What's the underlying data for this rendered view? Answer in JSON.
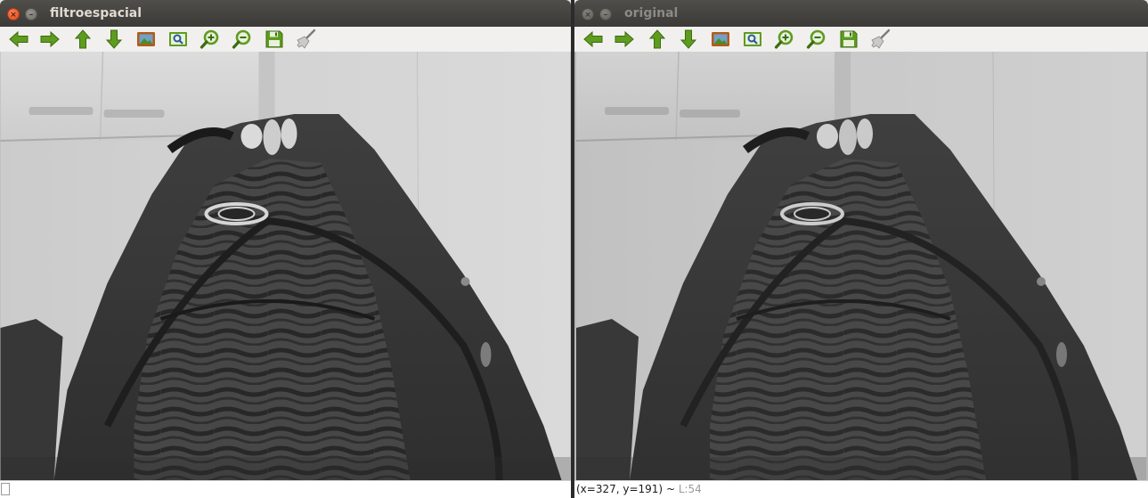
{
  "windows": [
    {
      "title": "filtroespacial",
      "focused": true,
      "status": {
        "coords": "",
        "tilde": "",
        "lum": ""
      }
    },
    {
      "title": "original",
      "focused": false,
      "status": {
        "coords": "(x=327, y=191)",
        "tilde": " ~ ",
        "lum": "L:54"
      }
    }
  ],
  "window_controls": {
    "close_symbol": "×",
    "minimize_symbol": "–"
  },
  "toolbar_icons": [
    "arrow-left-icon",
    "arrow-right-icon",
    "arrow-up-icon",
    "arrow-down-icon",
    "image-icon",
    "zoom-fit-icon",
    "zoom-in-icon",
    "zoom-out-icon",
    "save-icon",
    "brush-icon"
  ],
  "colors": {
    "icon_green": "#5e9c1f",
    "titlebar_dark": "#3c3b37",
    "close_orange": "#e9531c"
  }
}
